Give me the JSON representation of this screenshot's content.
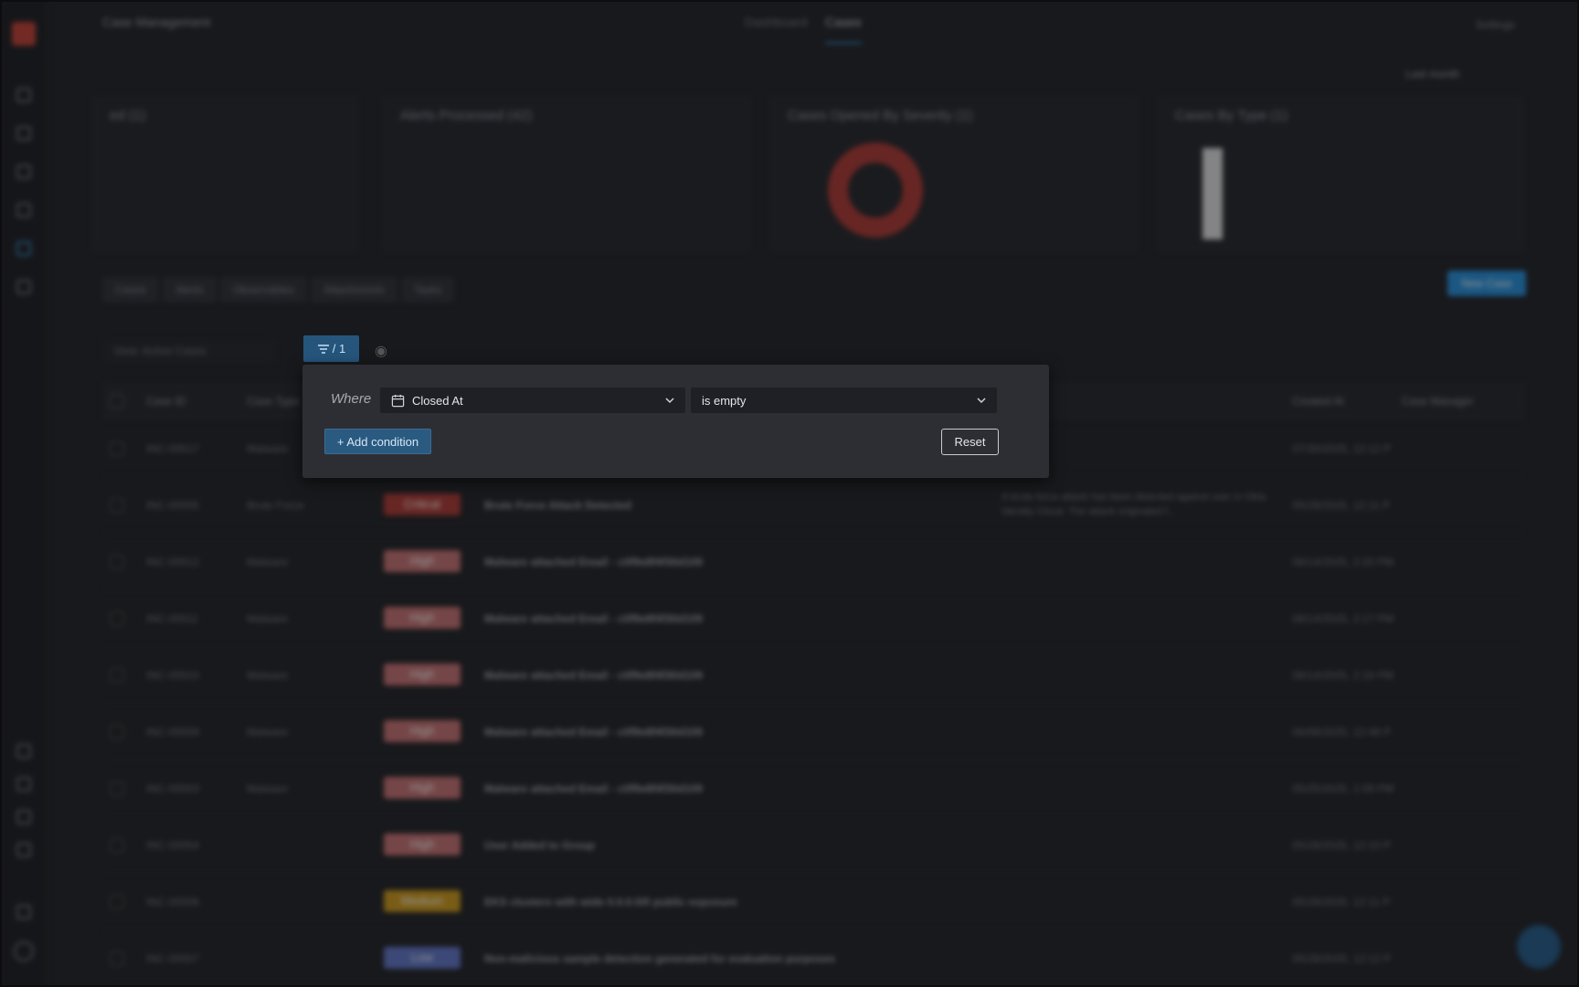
{
  "app": {
    "title": "Case Management",
    "tabs": [
      "Dashboard",
      "Cases"
    ],
    "settings_label": "Settings",
    "time_range": "Last month"
  },
  "cards": [
    {
      "title": "ed (1)"
    },
    {
      "title": "Alerts Processed (42)"
    },
    {
      "title": "Cases Opened By Severity (1)"
    },
    {
      "title": "Cases By Type (1)"
    }
  ],
  "sub_tabs": [
    "Cases",
    "Alerts",
    "Observables",
    "Attachments",
    "Tasks"
  ],
  "new_case_label": "New Case",
  "view_select": "View: Active Cases",
  "table": {
    "headers": [
      "Case ID",
      "Case Type",
      "Created At",
      "Case Manager"
    ],
    "rows": [
      {
        "id": "INC-00017",
        "type": "Malware",
        "severity": "",
        "title": "",
        "date": "07/30/2025, 12:12 P"
      },
      {
        "id": "INC-00005",
        "type": "Brute Force",
        "severity": "Critical",
        "title": "Brute Force Attack Detected",
        "desc": "A brute force attack has been detected against user in Okta Identity Cloud. The attack originated f...",
        "date": "05/28/2025, 12:11 P"
      },
      {
        "id": "INC-00012",
        "type": "Malware",
        "severity": "High",
        "title": "Malware attached Email - c0f9e8f4f30d109",
        "date": "06/14/2025, 2:20 PM"
      },
      {
        "id": "INC-00011",
        "type": "Malware",
        "severity": "High",
        "title": "Malware attached Email - c0f9e8f4f30d109",
        "date": "06/14/2025, 2:17 PM"
      },
      {
        "id": "INC-00010",
        "type": "Malware",
        "severity": "High",
        "title": "Malware attached Email - c0f9e8f4f30d109",
        "date": "06/14/2025, 2:16 PM"
      },
      {
        "id": "INC-00009",
        "type": "Malware",
        "severity": "High",
        "title": "Malware attached Email - c0f9e8f4f30d109",
        "date": "06/08/2025, 12:46 P"
      },
      {
        "id": "INC-00003",
        "type": "Malware",
        "severity": "High",
        "title": "Malware attached Email - c0f9e8f4f30d109",
        "date": "05/25/2025, 1:09 PM"
      },
      {
        "id": "INC-00004",
        "type": "",
        "severity": "High",
        "title": "User Added to Group",
        "date": "05/28/2025, 12:10 P"
      },
      {
        "id": "INC-00006",
        "type": "",
        "severity": "Medium",
        "title": "EKS clusters with wide 0.0.0.0/0 public exposure",
        "date": "05/28/2025, 12:11 P"
      },
      {
        "id": "INC-00007",
        "type": "",
        "severity": "Low",
        "title": "Non-malicious sample detection generated for evaluation purposes",
        "date": "05/28/2025, 12:12 P"
      }
    ]
  },
  "filter": {
    "toggle_label": "/ 1",
    "where_label": "Where",
    "field_value": "Closed At",
    "operator_value": "is empty",
    "add_condition_label": "+ Add condition",
    "reset_label": "Reset"
  },
  "colors": {
    "critical": "#a8312a",
    "high": "#c26b6b",
    "medium": "#c99410",
    "low": "#5a6fc2",
    "accent": "#1e8ad6"
  }
}
